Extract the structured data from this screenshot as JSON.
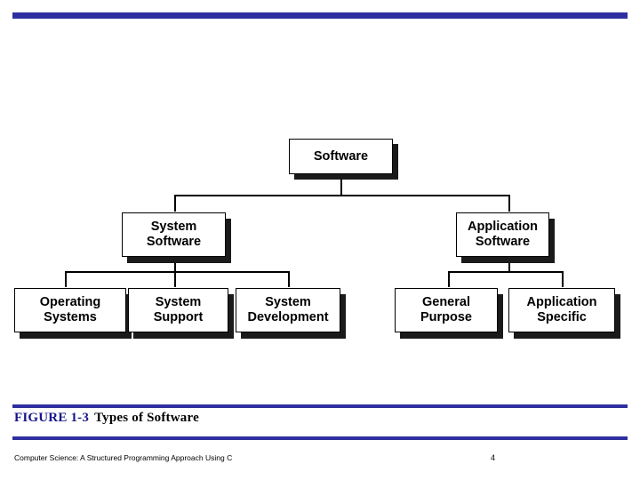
{
  "slide": {
    "caption_label": "FIGURE 1-3",
    "caption_title": "Types of Software",
    "footer_text": "Computer Science: A Structured Programming Approach Using C",
    "page_number": "4",
    "accent_color": "#2f2f9f",
    "caption_label_color": "#15158a"
  },
  "diagram": {
    "type": "hierarchy-tree",
    "nodes": [
      {
        "id": "software",
        "label": "Software",
        "level": 0
      },
      {
        "id": "system-software",
        "label": "System\nSoftware",
        "level": 1
      },
      {
        "id": "application-software",
        "label": "Application\nSoftware",
        "level": 1
      },
      {
        "id": "operating-systems",
        "label": "Operating\nSystems",
        "level": 2
      },
      {
        "id": "system-support",
        "label": "System\nSupport",
        "level": 2
      },
      {
        "id": "system-development",
        "label": "System\nDevelopment",
        "level": 2
      },
      {
        "id": "general-purpose",
        "label": "General\nPurpose",
        "level": 2
      },
      {
        "id": "application-specific",
        "label": "Application\nSpecific",
        "level": 2
      }
    ],
    "edges": [
      {
        "from": "software",
        "to": "system-software"
      },
      {
        "from": "software",
        "to": "application-software"
      },
      {
        "from": "system-software",
        "to": "operating-systems"
      },
      {
        "from": "system-software",
        "to": "system-support"
      },
      {
        "from": "system-software",
        "to": "system-development"
      },
      {
        "from": "application-software",
        "to": "general-purpose"
      },
      {
        "from": "application-software",
        "to": "application-specific"
      }
    ]
  }
}
